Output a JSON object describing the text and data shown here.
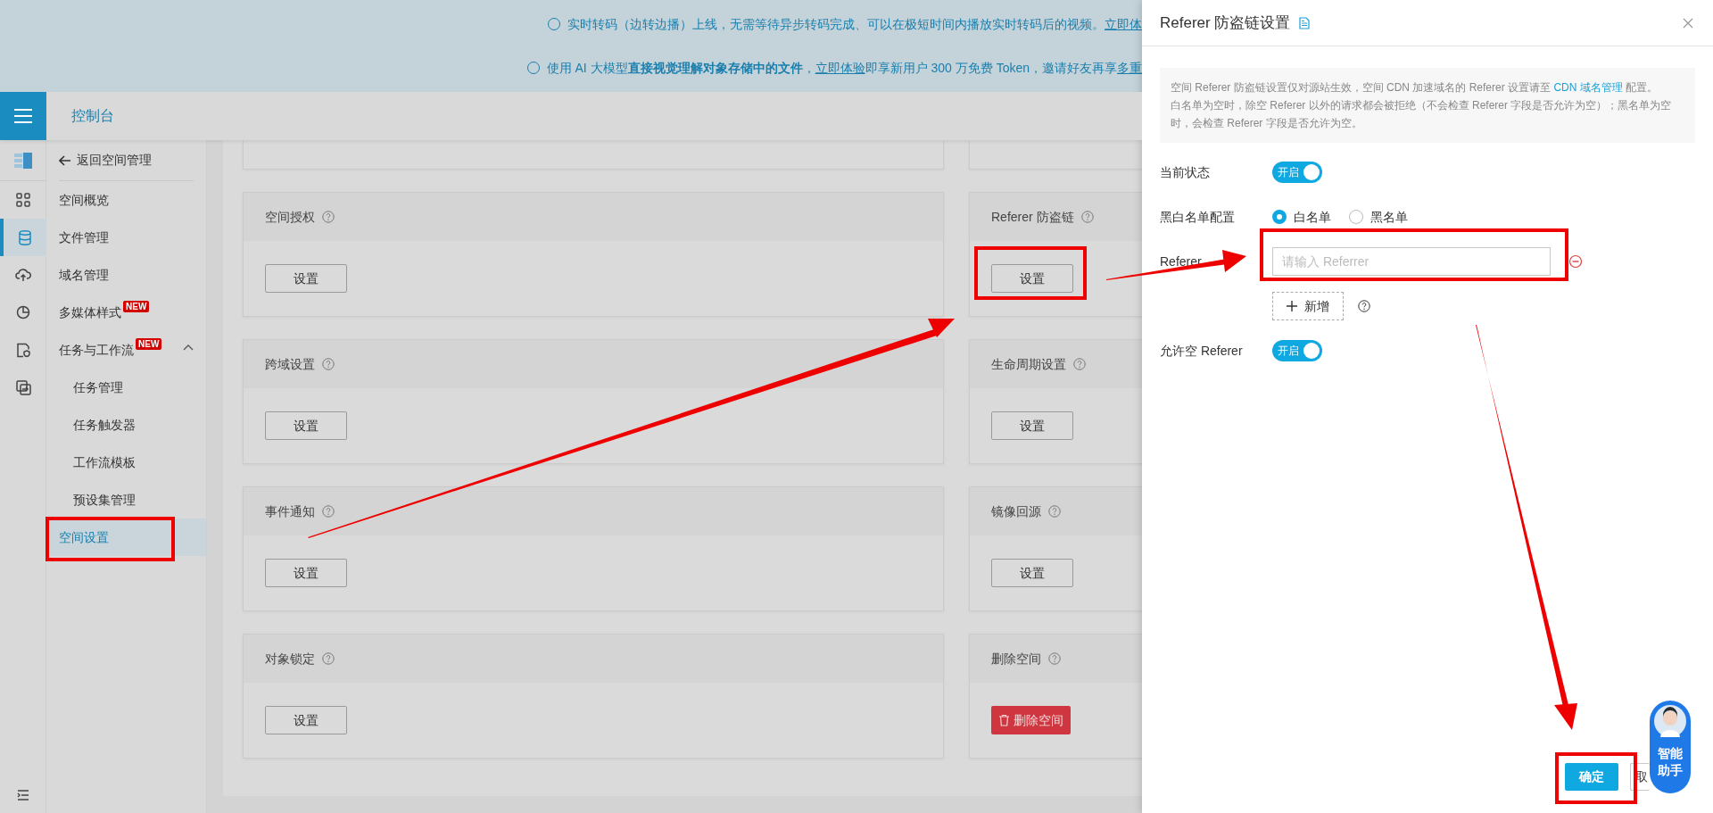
{
  "banner": {
    "notices": [
      {
        "parts": [
          {
            "kind": "text",
            "text": "实时转码（边转边播）上线，无需等待异步转码完成、可以在极短时间内播放实时转码后的视频。"
          },
          {
            "kind": "link",
            "text": "立即体"
          }
        ]
      },
      {
        "parts": [
          {
            "kind": "text",
            "text": "使用 AI 大模型**直接视觉理解对象存储中的文件**，"
          },
          {
            "kind": "link",
            "text": "立即体验"
          },
          {
            "kind": "text",
            "text": "即享新用户 300 万免费 Token，邀请好友再享"
          },
          {
            "kind": "link",
            "text": "多重"
          }
        ]
      }
    ]
  },
  "header": {
    "title": "控制台"
  },
  "rail": [
    {
      "kind": "logo",
      "selected": false
    },
    {
      "kind": "grid",
      "selected": false
    },
    {
      "kind": "database",
      "selected": true
    },
    {
      "kind": "cloud",
      "selected": false
    },
    {
      "kind": "pie",
      "selected": false
    },
    {
      "kind": "file",
      "selected": false
    },
    {
      "kind": "swap",
      "selected": false
    }
  ],
  "nav": {
    "back": "返回空间管理",
    "items": [
      {
        "label": "空间概览",
        "selected": false
      },
      {
        "label": "文件管理",
        "selected": false
      },
      {
        "label": "域名管理",
        "selected": false
      },
      {
        "label": "多媒体样式",
        "badge": "NEW",
        "selected": false
      },
      {
        "label": "任务与工作流",
        "badge": "NEW",
        "expanded": true,
        "selected": false,
        "children": [
          {
            "label": "任务管理",
            "selected": false
          },
          {
            "label": "任务触发器",
            "selected": false
          },
          {
            "label": "工作流模板",
            "selected": false
          },
          {
            "label": "预设集管理",
            "selected": false
          }
        ]
      },
      {
        "label": "空间设置",
        "selected": true
      }
    ]
  },
  "cards": [
    {
      "title": "空间授权",
      "button": "设置",
      "kind": "default"
    },
    {
      "title": "Referer 防盗链",
      "button": "设置",
      "kind": "default"
    },
    {
      "title": "跨域设置",
      "button": "设置",
      "kind": "default"
    },
    {
      "title": "生命周期设置",
      "button": "设置",
      "kind": "default"
    },
    {
      "title": "事件通知",
      "button": "设置",
      "kind": "default"
    },
    {
      "title": "镜像回源",
      "button": "设置",
      "kind": "default"
    },
    {
      "title": "对象锁定",
      "button": "设置",
      "kind": "default"
    },
    {
      "title": "删除空间",
      "button": "删除空间",
      "kind": "danger"
    }
  ],
  "drawer": {
    "title": "Referer 防盗链设置",
    "info": [
      {
        "parts": [
          {
            "kind": "text",
            "text": "空间 Referer 防盗链设置仅对源站生效，空间 CDN 加速域名的 Referer 设置请至 "
          },
          {
            "kind": "link",
            "text": "CDN 域名管理"
          },
          {
            "kind": "text",
            "text": " 配置。"
          }
        ]
      },
      {
        "parts": [
          {
            "kind": "text",
            "text": "白名单为空时，除空 Referer 以外的请求都会被拒绝（不会检查 Referer 字段是否允许为空）；黑名单为空时，会检查 Referer 字段是否允许为空。"
          }
        ]
      }
    ],
    "form": [
      {
        "kind": "toggle",
        "label": "当前状态",
        "on": true,
        "text": "开启"
      },
      {
        "kind": "radio",
        "label": "黑白名单配置",
        "options": [
          {
            "label": "白名单",
            "selected": true
          },
          {
            "label": "黑名单",
            "selected": false
          }
        ]
      },
      {
        "kind": "input",
        "label": "Referer",
        "placeholder": "请输入 Referrer"
      },
      {
        "kind": "add",
        "button": "新增"
      },
      {
        "kind": "toggle",
        "label": "允许空 Referer",
        "on": true,
        "text": "开启"
      }
    ],
    "buttons": [
      {
        "label": "确定",
        "kind": "primary"
      },
      {
        "label": "取",
        "kind": "default"
      }
    ]
  },
  "assistant": {
    "label": "智能助手"
  }
}
